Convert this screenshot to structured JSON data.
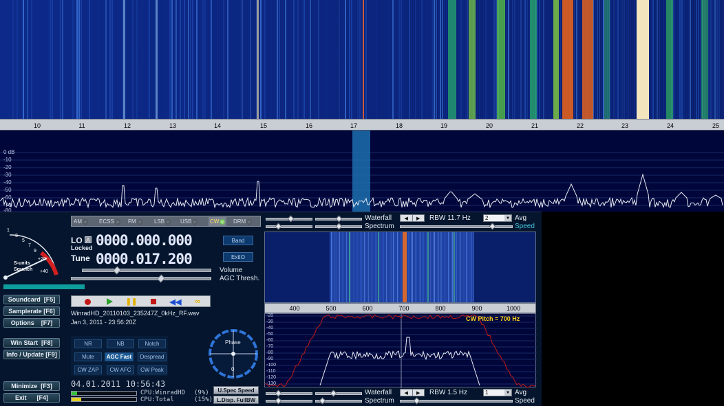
{
  "main_axis": {
    "ticks": [
      "10",
      "11",
      "12",
      "13",
      "14",
      "15",
      "16",
      "17",
      "18",
      "19",
      "20",
      "21",
      "22",
      "23",
      "24",
      "25"
    ]
  },
  "main_spectrum": {
    "db_labels": [
      "0 dB",
      "-10",
      "-20",
      "-30",
      "-40",
      "-50",
      "-60",
      "-70",
      "-80"
    ]
  },
  "modes": [
    {
      "label": "AM",
      "active": false
    },
    {
      "label": "ECSS",
      "active": false
    },
    {
      "label": "FM",
      "active": false
    },
    {
      "label": "LSB",
      "active": false
    },
    {
      "label": "USB",
      "active": false
    },
    {
      "label": "CW",
      "active": true
    },
    {
      "label": "DRM",
      "active": false
    }
  ],
  "smeter": {
    "label_line1": "S-units",
    "label_line2": "Squelch",
    "scale": [
      "1",
      "3",
      "5",
      "7",
      "9",
      "+20",
      "+40"
    ]
  },
  "lo": {
    "label": "LO",
    "badge": "A",
    "status": "Locked",
    "value": "0000.000.000"
  },
  "tune": {
    "label": "Tune",
    "value": "0000.017.200"
  },
  "band_button": "Band",
  "extio_button": "ExtIO",
  "volume_label": "Volume",
  "agc_label": "AGC Thresh.",
  "side_buttons": {
    "soundcard": "Soundcard  [F5]",
    "samplerate": "Samplerate [F6]",
    "options": "Options    [F7]",
    "win_start": "Win Start  [F8]",
    "info_update": "Info / Update [F9]",
    "minimize": "Minimize  [F3]",
    "exit": "Exit      [F4]"
  },
  "file": {
    "name": "WinradHD_20110103_235247Z_0kHz_RF.wav",
    "date": "Jan 3, 2011 - 23:56:20Z"
  },
  "dsp": {
    "nr": "NR",
    "nb": "NB",
    "notch": "Notch",
    "mute": "Mute",
    "agc_fast": "AGC Fast",
    "despread": "Despread",
    "cw_zap": "CW ZAP",
    "cw_afc": "CW AFC",
    "cw_peak": "CW Peak"
  },
  "phase": {
    "label": "Phase",
    "value": "0"
  },
  "clock": "04.01.2011 10:56:43",
  "cpu": {
    "winrad_label": "CPU:WinradHD",
    "winrad_value": "(9%)",
    "total_label": "CPU:Total",
    "total_value": "(15%)",
    "winrad_fraction": 0.09,
    "total_fraction": 0.15
  },
  "status_buttons": {
    "uspec": "U.Spec Speed",
    "ldisp": "L.Disp. FullBW"
  },
  "upper_controls": {
    "waterfall": "Waterfall",
    "rbw": "RBW 11.7 Hz",
    "avg_value": "2",
    "avg_label": "Avg",
    "spectrum": "Spectrum",
    "speed": "Speed"
  },
  "lower_controls": {
    "waterfall": "Waterfall",
    "rbw": "RBW  1.5 Hz",
    "avg_value": "1",
    "avg_label": "Avg",
    "spectrum": "Spectrum",
    "speed": "Speed"
  },
  "zoom_axis": {
    "ticks": [
      "400",
      "500",
      "600",
      "700",
      "800",
      "900",
      "1000"
    ]
  },
  "zoom_spectrum": {
    "db_labels": [
      "-20",
      "-30",
      "-40",
      "-50",
      "-60",
      "-70",
      "-80",
      "-90",
      "-100",
      "-110",
      "-120",
      "-130"
    ],
    "cw_pitch": "CW Pitch = 700 Hz"
  },
  "colors": {
    "waterfall_bg": "#0a1f6a",
    "spectrum_bg": "#00063a",
    "cw_active": "#ffe36a",
    "accent_red": "#c21818"
  }
}
